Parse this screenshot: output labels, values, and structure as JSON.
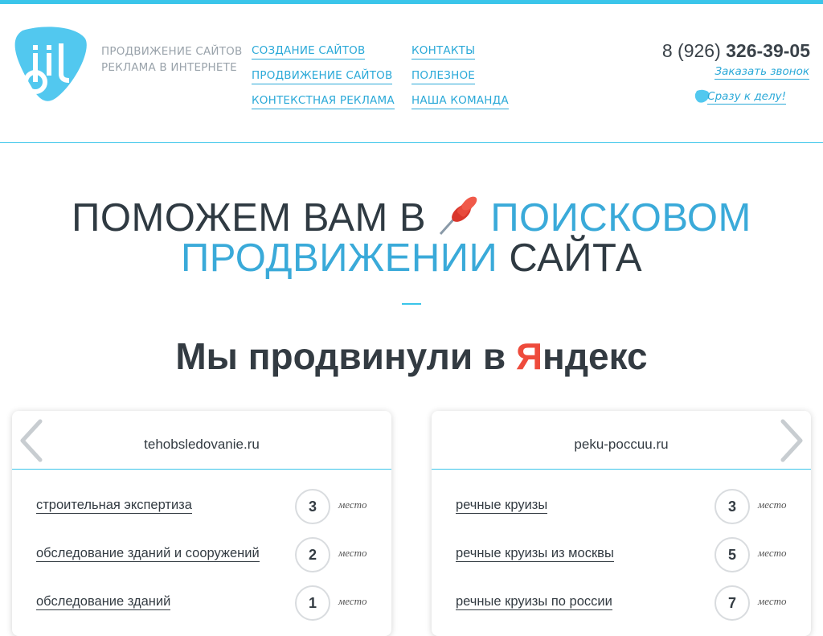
{
  "header": {
    "tagline": [
      "ПРОДВИЖЕНИЕ САЙТОВ",
      "РЕКЛАМА В ИНТЕРНЕТЕ"
    ],
    "nav_col1": [
      "СОЗДАНИЕ САЙТОВ",
      "ПРОДВИЖЕНИЕ САЙТОВ",
      "КОНТЕКСТНАЯ РЕКЛАМА"
    ],
    "nav_col2": [
      "КОНТАКТЫ",
      "ПОЛЕЗНОЕ",
      "НАША КОМАНДА"
    ],
    "phone_code": "8 (926)",
    "phone_number": "326-39-05",
    "callback": "Заказать звонок",
    "to_deal": "Сразу к делу!"
  },
  "hero": {
    "line1_dark": "ПОМОЖЕМ ВАМ В",
    "line1_blue": "ПОИСКОВОМ",
    "line2_blue": "ПРОДВИЖЕНИИ",
    "line2_dark": "САЙТА"
  },
  "subtitle": {
    "prefix": "Мы продвинули в ",
    "ya_red": "Я",
    "ya_rest": "ндекс"
  },
  "cards": [
    {
      "site": "tehobsledovanie.ru",
      "rows": [
        {
          "keyword": "строительная экспертиза",
          "position": "3",
          "unit": "место"
        },
        {
          "keyword": "обследование зданий и сооружений",
          "position": "2",
          "unit": "место"
        },
        {
          "keyword": "обследование зданий",
          "position": "1",
          "unit": "место"
        }
      ]
    },
    {
      "site": "peku-poccuu.ru",
      "rows": [
        {
          "keyword": "речные круизы",
          "position": "3",
          "unit": "место"
        },
        {
          "keyword": "речные круизы из москвы",
          "position": "5",
          "unit": "место"
        },
        {
          "keyword": "речные круизы по россии",
          "position": "7",
          "unit": "место"
        }
      ]
    }
  ],
  "colors": {
    "accent": "#3ac5ea",
    "link": "#2ba9d8",
    "yandex_red": "#ee4b3c"
  }
}
